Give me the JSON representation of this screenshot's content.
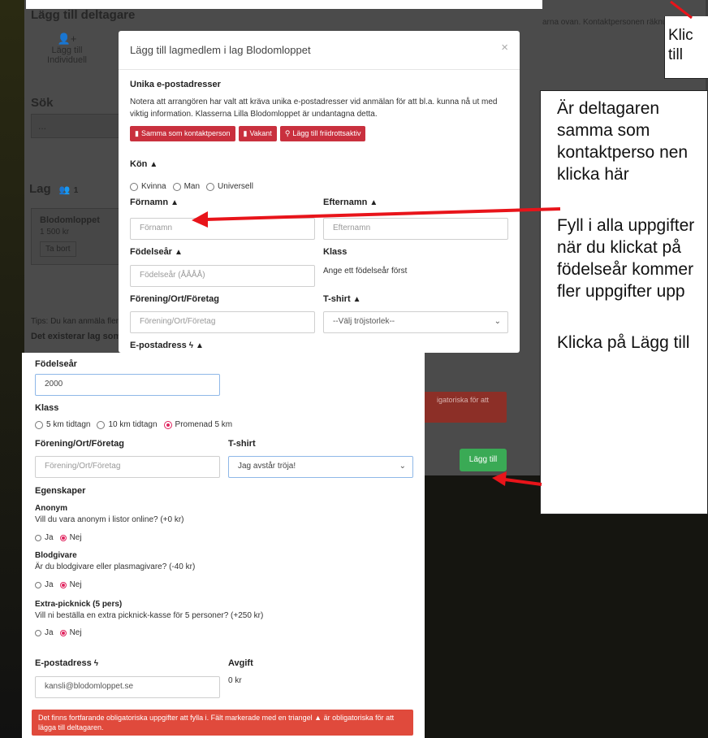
{
  "background": {
    "section_title": "Lägg till deltagare",
    "add_individual": "Lägg till Individuell",
    "search_title": "Sök",
    "search_placeholder": "...",
    "team_title": "Lag",
    "team_count": "1",
    "team_card_name": "Blodomloppet",
    "team_card_price": "1 500 kr",
    "team_card_remove": "Ta bort",
    "tips_text": "Tips: Du kan anmäla flera d",
    "exists_text": "Det existerar lag som",
    "note_text": "arna ovan. Kontaktpersonen räknu",
    "red_note": "igatoriska för att",
    "add_button": "Lägg till"
  },
  "modal": {
    "title": "Lägg till lagmedlem i lag Blodomloppet",
    "close": "×",
    "unique_heading": "Unika e-postadresser",
    "unique_text": "Notera att arrangören har valt att kräva unika e-postadresser vid anmälan för att bl.a. kunna nå ut med viktig information. Klasserna Lilla Blodomloppet är undantagna detta.",
    "buttons": [
      "Samma som kontaktperson",
      "Vakant",
      "Lägg till friidrottsaktiv"
    ],
    "gender_label": "Kön",
    "gender_options": [
      "Kvinna",
      "Man",
      "Universell"
    ],
    "firstname_label": "Förnamn",
    "firstname_placeholder": "Förnamn",
    "lastname_label": "Efternamn",
    "lastname_placeholder": "Efternamn",
    "birthyear_label": "Födelseår",
    "birthyear_placeholder": "Födelseår (ÅÅÅÅ)",
    "class_label": "Klass",
    "class_hint": "Ange ett födelseår först",
    "club_label": "Förening/Ort/Företag",
    "club_placeholder": "Förening/Ort/Företag",
    "tshirt_label": "T-shirt",
    "tshirt_value": "--Välj tröjstorlek--",
    "email_label": "E-postadress"
  },
  "lower": {
    "birthyear_label": "Födelseår",
    "birthyear_value": "2000",
    "class_label": "Klass",
    "class_options": [
      "5 km tidtagn",
      "10 km tidtagn",
      "Promenad 5 km"
    ],
    "club_label": "Förening/Ort/Företag",
    "club_placeholder": "Förening/Ort/Företag",
    "tshirt_label": "T-shirt",
    "tshirt_value": "Jag avstår tröja!",
    "properties_label": "Egenskaper",
    "anon_title": "Anonym",
    "anon_text": "Vill du vara anonym i listor online? (+0 kr)",
    "blood_title": "Blodgivare",
    "blood_text": "Är du blodgivare eller plasmagivare? (-40 kr)",
    "picnic_title": "Extra-picknick (5 pers)",
    "picnic_text": "Vill ni beställa en extra picknick-kasse för 5 personer? (+250 kr)",
    "ja": "Ja",
    "nej": "Nej",
    "email_label": "E-postadress",
    "email_value": "kansli@blodomloppet.se",
    "fee_label": "Avgift",
    "fee_value": "0 kr",
    "error_text": "Det finns fortfarande obligatoriska uppgifter att fylla i. Fält markerade med en triangel ▲ är obligatoriska för att lägga till deltagaren."
  },
  "instructions": {
    "p1": "Är deltagaren samma som kontaktperso nen klicka här",
    "p2": "Fyll i alla uppgifter när du klickat på födelseår kommer fler uppgifter upp",
    "p3": "Klicka på Lägg till",
    "corner_line1": "Klic",
    "corner_line2": "till"
  },
  "colors": {
    "red_button": "#c9303e",
    "green_button": "#3aaa55",
    "error_bar": "#e04a3c",
    "arrow": "#e8141a"
  }
}
